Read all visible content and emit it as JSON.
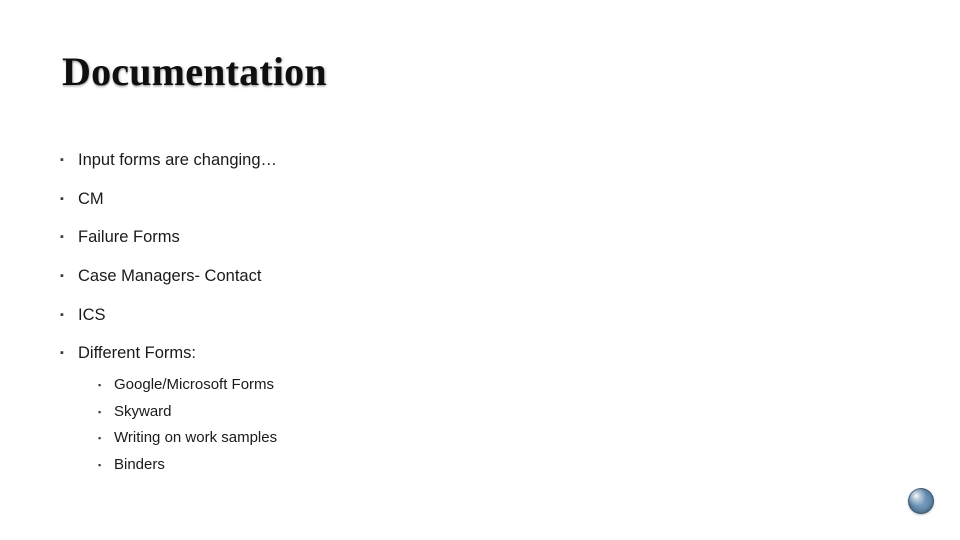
{
  "title": "Documentation",
  "bullets": [
    {
      "text": "Input forms are changing…"
    },
    {
      "text": "CM"
    },
    {
      "text": "Failure Forms"
    },
    {
      "text": "Case Managers- Contact"
    },
    {
      "text": "ICS"
    },
    {
      "text": "Different Forms:",
      "children": [
        "Google/Microsoft Forms",
        "Skyward",
        "Writing on work samples",
        "Binders"
      ]
    }
  ]
}
